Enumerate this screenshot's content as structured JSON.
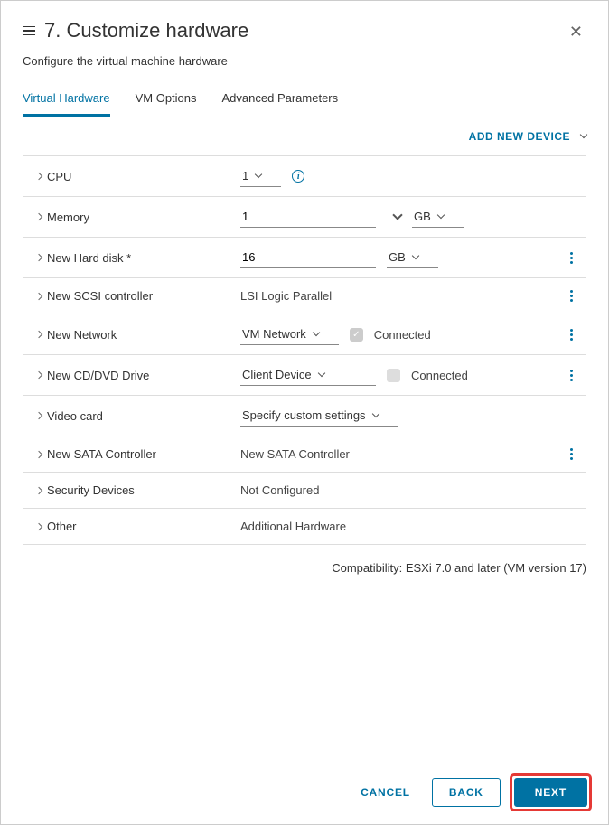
{
  "header": {
    "title": "7. Customize hardware",
    "subtitle": "Configure the virtual machine hardware"
  },
  "tabs": [
    "Virtual Hardware",
    "VM Options",
    "Advanced Parameters"
  ],
  "add_device_label": "ADD NEW DEVICE",
  "rows": {
    "cpu": {
      "label": "CPU",
      "value": "1"
    },
    "memory": {
      "label": "Memory",
      "value": "1",
      "unit": "GB"
    },
    "hdd": {
      "label": "New Hard disk *",
      "value": "16",
      "unit": "GB"
    },
    "scsi": {
      "label": "New SCSI controller",
      "value": "LSI Logic Parallel"
    },
    "network": {
      "label": "New Network",
      "value": "VM Network",
      "connected": "Connected"
    },
    "cddvd": {
      "label": "New CD/DVD Drive",
      "value": "Client Device",
      "connected": "Connected"
    },
    "video": {
      "label": "Video card",
      "value": "Specify custom settings"
    },
    "sata": {
      "label": "New SATA Controller",
      "value": "New SATA Controller"
    },
    "security": {
      "label": "Security Devices",
      "value": "Not Configured"
    },
    "other": {
      "label": "Other",
      "value": "Additional Hardware"
    }
  },
  "compat": "Compatibility: ESXi 7.0 and later (VM version 17)",
  "footer": {
    "cancel": "CANCEL",
    "back": "BACK",
    "next": "NEXT"
  }
}
